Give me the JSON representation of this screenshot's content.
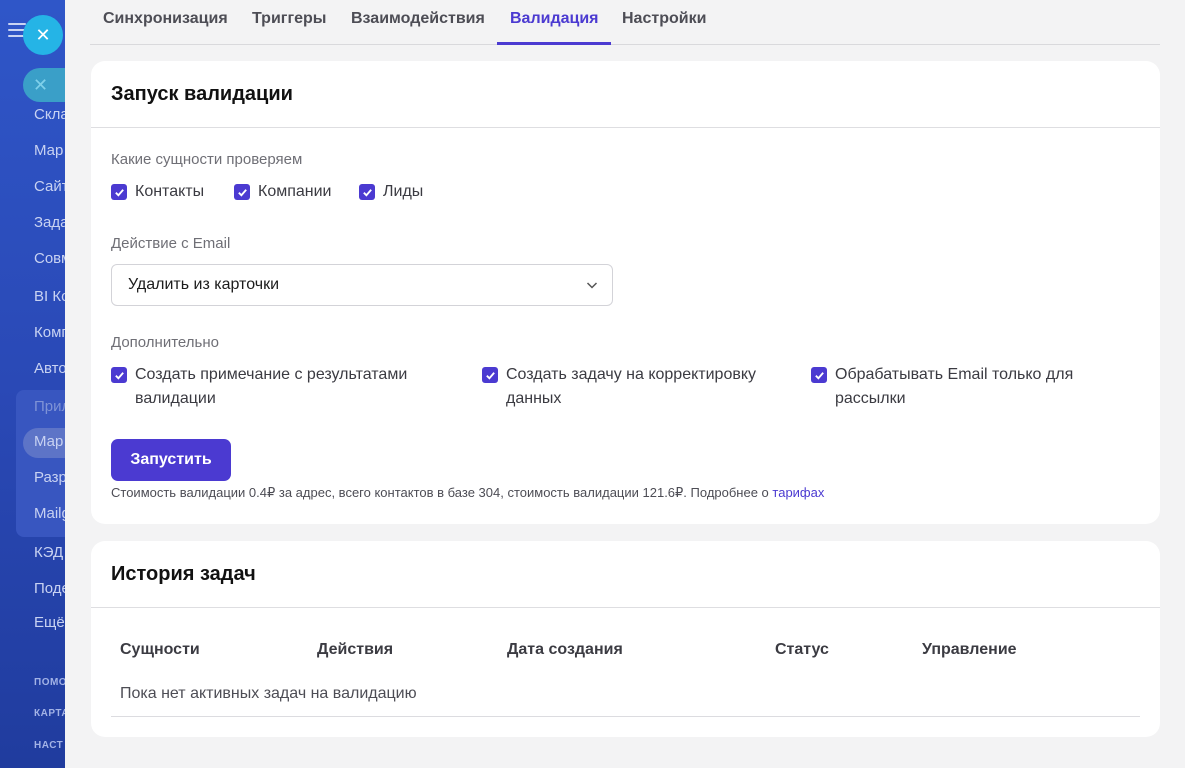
{
  "sidebar": {
    "items": [
      {
        "label": "Скла",
        "dim": false
      },
      {
        "label": "Мар",
        "dim": false
      },
      {
        "label": "Сайт",
        "dim": false
      },
      {
        "label": "Зада",
        "dim": false
      },
      {
        "label": "Совм",
        "dim": false
      },
      {
        "label": "BI Ко",
        "dim": false
      },
      {
        "label": "Комп",
        "dim": false
      },
      {
        "label": "Авто",
        "dim": false
      },
      {
        "label": "Прил",
        "dim": true
      },
      {
        "label": "Мар",
        "dim": false
      },
      {
        "label": "Разр",
        "dim": false
      },
      {
        "label": "Mailg",
        "dim": false
      },
      {
        "label": "КЭД",
        "dim": false
      },
      {
        "label": "Поде",
        "dim": false
      },
      {
        "label": "Ещё",
        "dim": false
      }
    ],
    "footer": [
      "ПОМО",
      "КАРТА",
      "НАСТ"
    ]
  },
  "tabs": [
    {
      "label": "Синхронизация"
    },
    {
      "label": "Триггеры"
    },
    {
      "label": "Взаимодействия"
    },
    {
      "label": "Валидация",
      "active": true
    },
    {
      "label": "Настройки"
    }
  ],
  "validation": {
    "title": "Запуск валидации",
    "entities_label": "Какие сущности проверяем",
    "entities": [
      "Контакты",
      "Компании",
      "Лиды"
    ],
    "email_action_label": "Действие с Email",
    "email_action_value": "Удалить из карточки",
    "extra_label": "Дополнительно",
    "extras": [
      "Создать примечание с результатами валидации",
      "Создать задачу на корректировку данных",
      "Обрабатывать Email только для рассылки"
    ],
    "run_button": "Запустить",
    "cost_text": "Стоимость валидации 0.4₽ за адрес, всего контактов в базе 304, стоимость валидации 121.6₽. Подробнее о ",
    "cost_link": "тарифах"
  },
  "history": {
    "title": "История задач",
    "columns": [
      "Сущности",
      "Действия",
      "Дата создания",
      "Статус",
      "Управление"
    ],
    "empty_text": "Пока нет активных задач на валидацию"
  },
  "colors": {
    "accent": "#4b3ad1",
    "sidebar": "#2a46b4",
    "close_button": "#25b4e6"
  }
}
